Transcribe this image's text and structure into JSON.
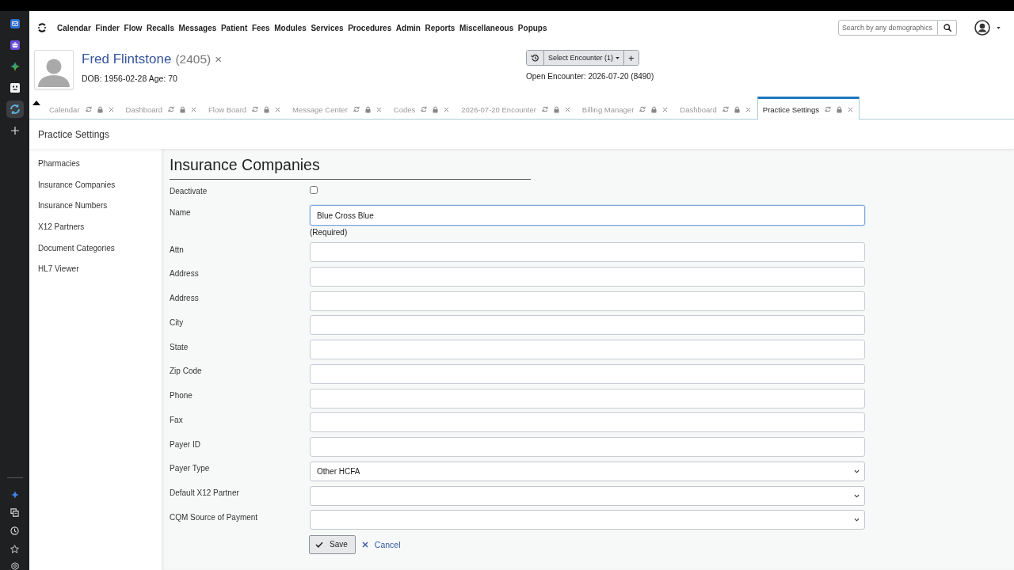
{
  "rail": [
    {
      "selected": false
    },
    {
      "selected": false
    },
    {
      "selected": false
    },
    {
      "selected": false
    },
    {
      "selected": true
    }
  ],
  "menu": [
    "Calendar",
    "Finder",
    "Flow",
    "Recalls",
    "Messages",
    "Patient",
    "Fees",
    "Modules",
    "Services",
    "Procedures",
    "Admin",
    "Reports",
    "Miscellaneous",
    "Popups"
  ],
  "search": {
    "placeholder": "Search by any demographics"
  },
  "patient": {
    "name": "Fred Flintstone",
    "pid": "(2405)",
    "close": "×",
    "dob": "DOB: 1956-02-28 Age: 70"
  },
  "encounter": {
    "select": "Select Encounter (1)",
    "add": "+",
    "open": "Open Encounter: 2026-07-20 (8490)"
  },
  "tabs": [
    {
      "label": "Calendar",
      "selected": false
    },
    {
      "label": "Dashboard",
      "selected": false
    },
    {
      "label": "Flow Board",
      "selected": false
    },
    {
      "label": "Message Center",
      "selected": false
    },
    {
      "label": "Codes",
      "selected": false
    },
    {
      "label": "2026-07-20 Encounter",
      "selected": false
    },
    {
      "label": "Billing Manager",
      "selected": false
    },
    {
      "label": "Dashboard",
      "selected": false
    },
    {
      "label": "Practice Settings",
      "selected": true
    }
  ],
  "page": {
    "title": "Practice Settings",
    "nav": [
      "Pharmacies",
      "Insurance Companies",
      "Insurance Numbers",
      "X12 Partners",
      "Document Categories",
      "HL7 Viewer"
    ]
  },
  "form": {
    "title": "Insurance Companies",
    "fields": [
      {
        "kind": "checkbox",
        "label": "Deactivate",
        "checked": false
      },
      {
        "kind": "text",
        "label": "Name",
        "value": "Blue Cross Blue",
        "focused": true,
        "note": "(Required)"
      },
      {
        "kind": "text",
        "label": "Attn",
        "focused": false
      },
      {
        "kind": "text",
        "label": "Address",
        "focused": false
      },
      {
        "kind": "text",
        "label": "Address",
        "focused": false
      },
      {
        "kind": "text",
        "label": "City",
        "focused": false
      },
      {
        "kind": "text",
        "label": "State",
        "focused": false
      },
      {
        "kind": "text",
        "label": "Zip Code",
        "focused": false
      },
      {
        "kind": "text",
        "label": "Phone",
        "focused": false
      },
      {
        "kind": "text",
        "label": "Fax",
        "focused": false
      },
      {
        "kind": "text",
        "label": "Payer ID",
        "focused": false
      },
      {
        "kind": "select",
        "label": "Payer Type",
        "value": "Other HCFA"
      },
      {
        "kind": "select",
        "label": "Default X12 Partner"
      },
      {
        "kind": "select",
        "label": "CQM Source of Payment"
      }
    ],
    "save": "Save",
    "cancel": "Cancel"
  }
}
